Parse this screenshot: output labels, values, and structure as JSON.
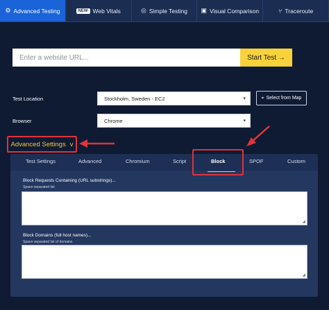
{
  "topnav": {
    "tabs": [
      {
        "label": "Advanced Testing",
        "icon": "gear-icon",
        "active": true
      },
      {
        "label": "Web Vitals",
        "icon": "new-badge",
        "badge": "NEW",
        "active": false
      },
      {
        "label": "Simple Testing",
        "icon": "check-circle-icon",
        "active": false
      },
      {
        "label": "Visual Comparison",
        "icon": "image-icon",
        "active": false
      },
      {
        "label": "Traceroute",
        "icon": "route-icon",
        "active": false
      }
    ]
  },
  "url": {
    "placeholder": "Enter a website URL...",
    "value": "",
    "start_label": "Start Test →"
  },
  "test_location": {
    "label": "Test Location",
    "value": "Stockholm, Sweden - EC2",
    "map_button": "Select from Map"
  },
  "browser": {
    "label": "Browser",
    "value": "Chrome"
  },
  "advanced": {
    "toggle_label": "Advanced Settings",
    "chevron": "v"
  },
  "subtabs": [
    {
      "label": "Test Settings"
    },
    {
      "label": "Advanced"
    },
    {
      "label": "Chromium"
    },
    {
      "label": "Script"
    },
    {
      "label": "Block",
      "active": true
    },
    {
      "label": "SPOF"
    },
    {
      "label": "Custom"
    }
  ],
  "block": {
    "requests_title": "Block Requests Containing (URL substrings)...",
    "requests_hint": "Space-separated list",
    "domains_title": "Block Domains (full host names)...",
    "domains_hint": "Space-separated list of domains"
  },
  "colors": {
    "accent_blue": "#1a63d8",
    "start_yellow": "#f7d23a",
    "highlight_red": "#e0333a",
    "toggle_text": "#f5c542",
    "background": "#0f1a33"
  }
}
